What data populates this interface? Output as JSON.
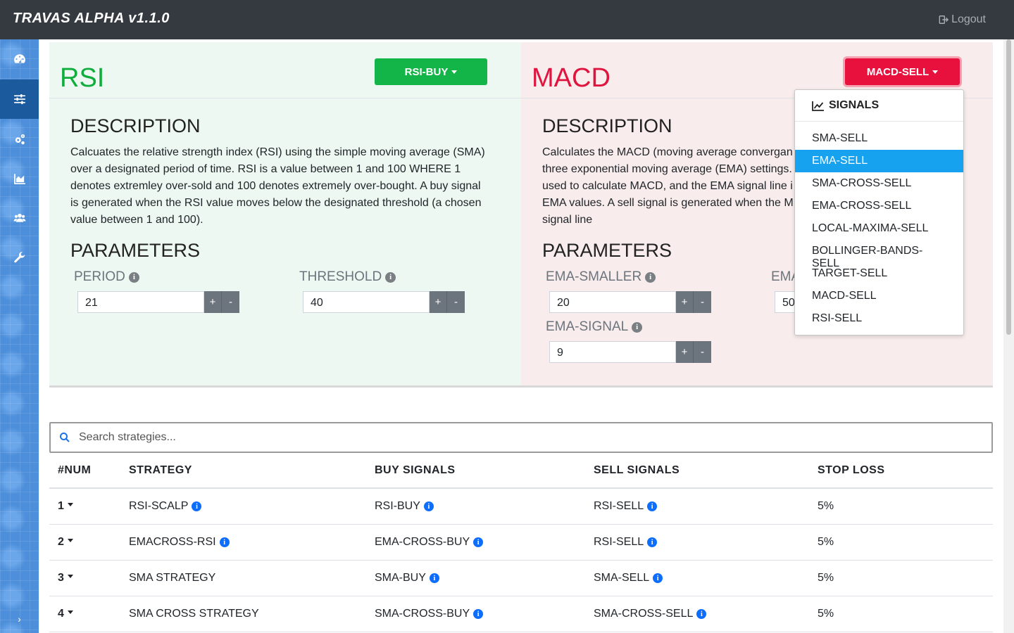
{
  "app": {
    "title": "TRAVAS ALPHA v1.1.0",
    "logout_label": "Logout"
  },
  "sidebar": {
    "items": [
      {
        "name": "dashboard-icon"
      },
      {
        "name": "sliders-icon",
        "active": true
      },
      {
        "name": "cogs-icon"
      },
      {
        "name": "area-chart-icon"
      },
      {
        "name": "users-icon"
      },
      {
        "name": "wrench-icon"
      }
    ],
    "toggle": "›"
  },
  "rsi": {
    "title": "RSI",
    "signal_button": "RSI-BUY",
    "description_heading": "DESCRIPTION",
    "description_lines": [
      "Calcuates the relative strength index (RSI) using the simple moving average (SMA)",
      "over a designated period of time. RSI is a value between 1 and 100 WHERE 1",
      "denotes extremley over-sold and 100 denotes extremely over-bought. A buy signal",
      "is generated when the RSI value moves below the designated threshold (a chosen",
      "value between 1 and 100)."
    ],
    "parameters_heading": "PARAMETERS",
    "params": [
      {
        "label": "PERIOD",
        "value": "21"
      },
      {
        "label": "THRESHOLD",
        "value": "40"
      }
    ]
  },
  "macd": {
    "title": "MACD",
    "signal_button": "MACD-SELL",
    "description_heading": "DESCRIPTION",
    "description_lines": [
      "Calculates the MACD (moving average convergan",
      "three exponential moving average (EMA) settings.",
      "used to calculate MACD, and the EMA signal line i",
      "EMA values. A sell signal is generated when the M",
      "signal line"
    ],
    "parameters_heading": "PARAMETERS",
    "params": [
      {
        "label": "EMA-SMALLER",
        "value": "20"
      },
      {
        "label": "EMA",
        "value": "50"
      },
      {
        "label": "EMA-SIGNAL",
        "value": "9"
      }
    ]
  },
  "stepper": {
    "plus": "+",
    "minus": "-"
  },
  "dropdown": {
    "header": "SIGNALS",
    "items": [
      "SMA-SELL",
      "EMA-SELL",
      "SMA-CROSS-SELL",
      "EMA-CROSS-SELL",
      "LOCAL-MAXIMA-SELL",
      "BOLLINGER-BANDS-SELL",
      "TARGET-SELL",
      "MACD-SELL",
      "RSI-SELL"
    ],
    "active_item": "EMA-SELL"
  },
  "search": {
    "placeholder": "Search strategies..."
  },
  "table": {
    "headers": [
      "#NUM",
      "STRATEGY",
      "BUY SIGNALS",
      "SELL SIGNALS",
      "STOP LOSS"
    ],
    "rows": [
      {
        "num": "1",
        "strategy": "RSI-SCALP",
        "buy": "RSI-BUY",
        "sell": "RSI-SELL",
        "stop_loss": "5%"
      },
      {
        "num": "2",
        "strategy": "EMACROSS-RSI",
        "buy": "EMA-CROSS-BUY",
        "sell": "RSI-SELL",
        "stop_loss": "5%"
      },
      {
        "num": "3",
        "strategy": "SMA STRATEGY",
        "buy": "SMA-BUY",
        "sell": "SMA-SELL",
        "stop_loss": "5%"
      },
      {
        "num": "4",
        "strategy": "SMA CROSS STRATEGY",
        "buy": "SMA-CROSS-BUY",
        "sell": "SMA-CROSS-SELL",
        "stop_loss": "5%"
      }
    ]
  },
  "colors": {
    "navbar": "#343a40",
    "sidebar": "#4d8fdb",
    "rsi_accent": "#0fad3c",
    "macd_accent": "#e0153f",
    "dropdown_active": "#17a2f0"
  }
}
